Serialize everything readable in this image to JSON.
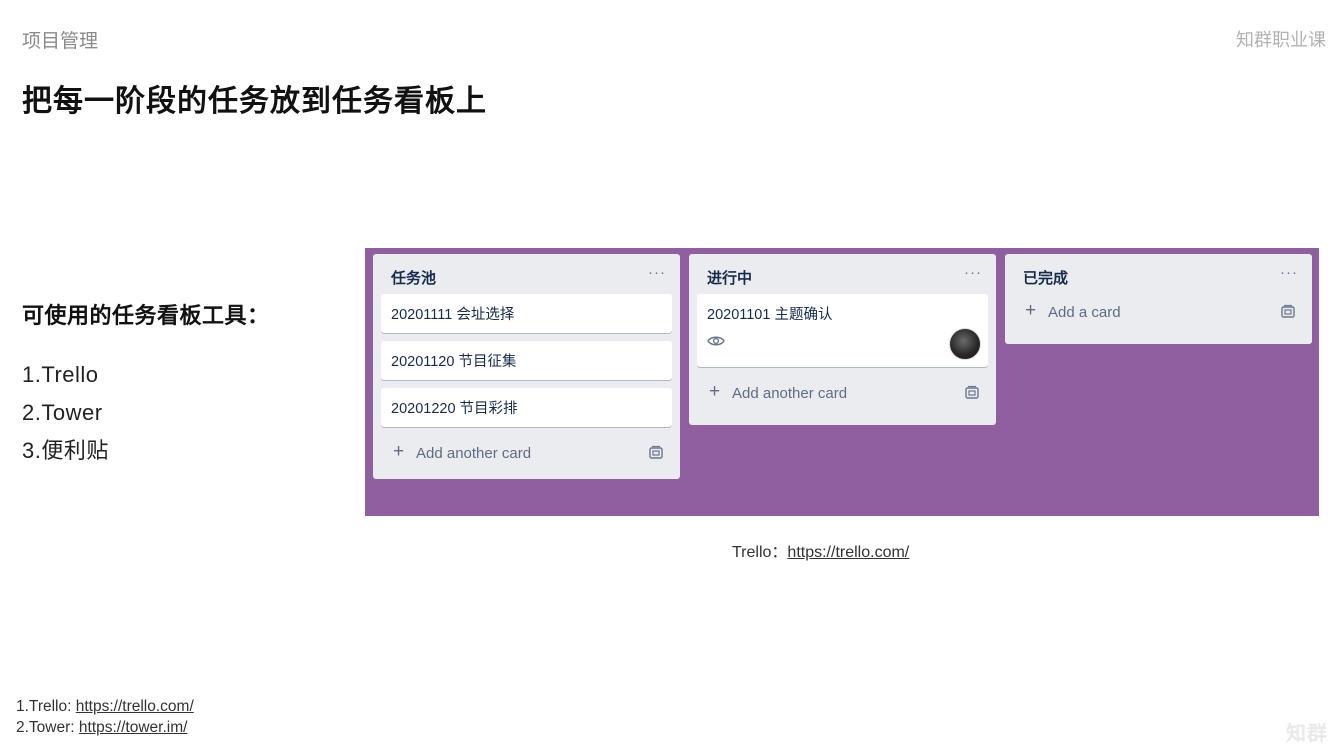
{
  "header": {
    "section": "项目管理",
    "brand": "知群职业课",
    "title": "把每一阶段的任务放到任务看板上"
  },
  "tools": {
    "heading": "可使用的任务看板工具：",
    "items": [
      "1.Trello",
      "2.Tower",
      "3.便利贴"
    ]
  },
  "board": {
    "background_color": "#8f5f9f",
    "lists": [
      {
        "title": "任务池",
        "menu": "···",
        "cards": [
          "20201111 会址选择",
          "20201120 节目征集",
          "20201220 节目彩排"
        ],
        "add_label": "Add another card"
      },
      {
        "title": "进行中",
        "menu": "···",
        "cards": [
          "20201101 主题确认"
        ],
        "add_label": "Add another card"
      },
      {
        "title": "已完成",
        "menu": "···",
        "cards": [],
        "add_label": "Add a card"
      }
    ],
    "add_plus": "+"
  },
  "caption": {
    "label": "Trello：",
    "link": "https://trello.com/"
  },
  "footnotes": [
    {
      "label": "1.Trello: ",
      "link": "https://trello.com/"
    },
    {
      "label": "2.Tower: ",
      "link": "https://tower.im/"
    }
  ],
  "watermark": "知群"
}
